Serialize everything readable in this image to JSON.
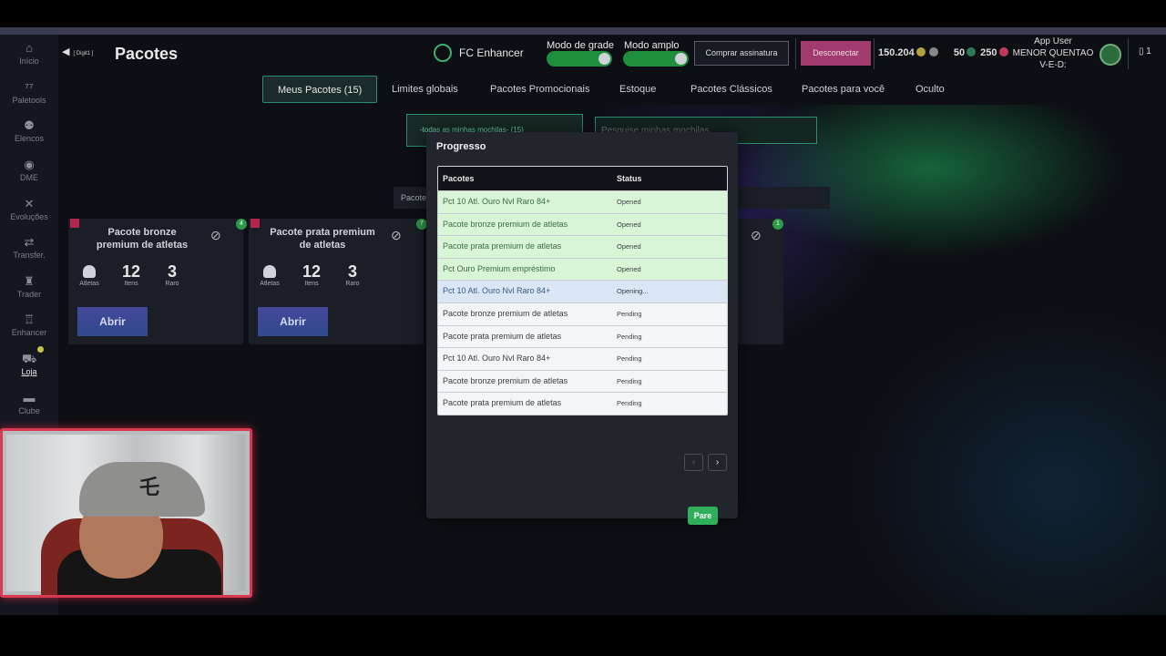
{
  "sidebar": {
    "items": [
      {
        "label": "Início",
        "icon": "home-icon",
        "glyph": "⌂"
      },
      {
        "label": "Paletools",
        "icon": "paletools-logo-icon",
        "glyph": "⁷⁷"
      },
      {
        "label": "Elencos",
        "icon": "squad-icon",
        "glyph": "⚉"
      },
      {
        "label": "DME",
        "icon": "globe-icon",
        "glyph": "◉"
      },
      {
        "label": "Evoluções",
        "icon": "evolutions-icon",
        "glyph": "✕"
      },
      {
        "label": "Transfer.",
        "icon": "transfer-icon",
        "glyph": "⇄"
      },
      {
        "label": "Trader",
        "icon": "shirt-icon",
        "glyph": "♜"
      },
      {
        "label": "Enhancer",
        "icon": "enhancer-icon",
        "glyph": "♖"
      },
      {
        "label": "Loja",
        "icon": "cart-icon",
        "glyph": "⛟"
      },
      {
        "label": "Clube",
        "icon": "club-icon",
        "glyph": "▬"
      }
    ]
  },
  "header": {
    "back_glyph": "◀",
    "back_hint": "[ Digit1 ]",
    "title": "Pacotes",
    "brand": "FC Enhancer",
    "grid_mode_label": "Modo de grade",
    "wide_mode_label": "Modo amplo",
    "subscribe_label": "Comprar assinatura",
    "disconnect_label": "Desconectar",
    "coins": "150.204",
    "points": "50",
    "tokens": "250",
    "user_line1": "App User",
    "user_line2": "MENOR QUENTAO",
    "user_line3": "V-E-D:",
    "phone_count": "1"
  },
  "tabs": [
    {
      "label": "Meus Pacotes (15)",
      "active": true
    },
    {
      "label": "Limites globais"
    },
    {
      "label": "Pacotes Promocionais"
    },
    {
      "label": "Estoque"
    },
    {
      "label": "Pacotes Clássicos"
    },
    {
      "label": "Pacotes para você"
    },
    {
      "label": "Oculto"
    }
  ],
  "filters": {
    "backpack_select": "-todas as minhas mochilas- (15)",
    "search_placeholder": "Pesquise minhas mochilas",
    "sort_label": "Pacote"
  },
  "cards": [
    {
      "title": "Pacote bronze premium de atletas",
      "badge": "4",
      "athletes_label": "Atletas",
      "items": "12",
      "items_label": "Itens",
      "rare": "3",
      "rare_label": "Raro",
      "open_label": "Abrir"
    },
    {
      "title": "Pacote prata premium de atletas",
      "badge": "7",
      "athletes_label": "Atletas",
      "items": "12",
      "items_label": "Itens",
      "rare": "3",
      "rare_label": "Raro",
      "open_label": "Abrir"
    }
  ],
  "partial_card_badge": "1",
  "modal": {
    "title": "Progresso",
    "col_packs": "Pacotes",
    "col_status": "Status",
    "rows": [
      {
        "pack": "Pct 10 Atl. Ouro Nvl Raro 84+",
        "status": "Opened"
      },
      {
        "pack": "Pacote bronze premium de atletas",
        "status": "Opened"
      },
      {
        "pack": "Pacote prata premium de atletas",
        "status": "Opened"
      },
      {
        "pack": "Pct Ouro Premium empréstimo",
        "status": "Opened"
      },
      {
        "pack": "Pct 10 Atl. Ouro Nvl Raro 84+",
        "status": "Opening..."
      },
      {
        "pack": "Pacote bronze premium de atletas",
        "status": "Pending"
      },
      {
        "pack": "Pacote prata premium de atletas",
        "status": "Pending"
      },
      {
        "pack": "Pct 10 Atl. Ouro Nvl Raro 84+",
        "status": "Pending"
      },
      {
        "pack": "Pacote bronze premium de atletas",
        "status": "Pending"
      },
      {
        "pack": "Pacote prata premium de atletas",
        "status": "Pending"
      }
    ],
    "prev_glyph": "‹",
    "next_glyph": "›",
    "stop_label": "Pare"
  },
  "colors": {
    "accent_green": "#2fae5b",
    "opened_row": "#d8f6d6",
    "opening_row": "#dae6f6",
    "disconnect": "#a13a6e",
    "webcam_border": "#d83a52"
  }
}
